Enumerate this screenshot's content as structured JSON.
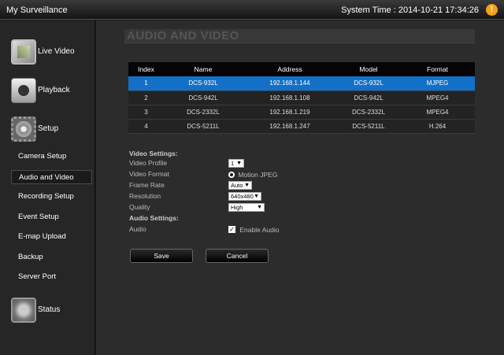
{
  "header": {
    "app_title": "My Surveillance",
    "system_time_label": "System Time : 2014-10-21 17:34:26",
    "alert_icon_glyph": "!"
  },
  "sidebar": {
    "main_items": [
      {
        "label": "Live Video",
        "icon": "live-video-icon"
      },
      {
        "label": "Playback",
        "icon": "playback-icon"
      },
      {
        "label": "Setup",
        "icon": "setup-gear-icon"
      },
      {
        "label": "Status",
        "icon": "status-icon"
      }
    ],
    "setup_items": [
      {
        "label": "Camera Setup"
      },
      {
        "label": "Audio and Video",
        "active": true
      },
      {
        "label": "Recording Setup"
      },
      {
        "label": "Event Setup"
      },
      {
        "label": "E-map Upload"
      },
      {
        "label": "Backup"
      },
      {
        "label": "Server Port"
      }
    ]
  },
  "page": {
    "title": "AUDIO AND VIDEO"
  },
  "camera_table": {
    "headers": [
      "Index",
      "Name",
      "Address",
      "Model",
      "Format"
    ],
    "rows": [
      {
        "index": "1",
        "name": "DCS-932L",
        "address": "192.168.1.144",
        "model": "DCS-932L",
        "format": "MJPEG",
        "selected": true
      },
      {
        "index": "2",
        "name": "DCS-942L",
        "address": "192.168.1.108",
        "model": "DCS-942L",
        "format": "MPEG4"
      },
      {
        "index": "3",
        "name": "DCS-2332L",
        "address": "192.168.1.219",
        "model": "DCS-2332L",
        "format": "MPEG4"
      },
      {
        "index": "4",
        "name": "DCS-5211L",
        "address": "192.168.1.247",
        "model": "DCS-5211L",
        "format": "H.264"
      }
    ]
  },
  "video_settings": {
    "heading": "Video Settings:",
    "profile_label": "Video Profile",
    "profile_value": "1",
    "format_label": "Video Format",
    "format_value": "Motion JPEG",
    "frame_rate_label": "Frame Rate",
    "frame_rate_value": "Auto",
    "resolution_label": "Resolution",
    "resolution_value": "640x480",
    "quality_label": "Quality",
    "quality_value": "High"
  },
  "audio_settings": {
    "heading": "Audio Settings:",
    "audio_label": "Audio",
    "enable_label": "Enable Audio",
    "enabled": true
  },
  "actions": {
    "save_label": "Save",
    "cancel_label": "Cancel"
  },
  "colors": {
    "selected_row": "#1470c7",
    "alert": "#f5a11c"
  }
}
